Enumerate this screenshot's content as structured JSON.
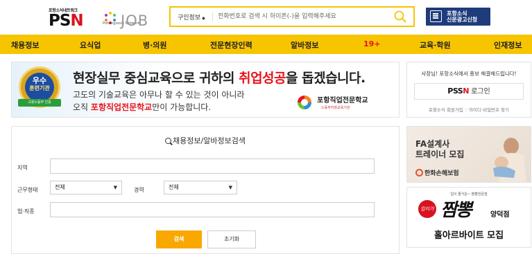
{
  "header": {
    "logo_tagline": "포항소식네트워크",
    "logo_psn_a": "PS",
    "logo_psn_b": "N",
    "logo_sub": "Pohangsosik Network",
    "logo_job": "JOB",
    "search_category": "구인정보",
    "search_placeholder": "전화번호로 검색 시 하이픈(-)을 입력해주세요",
    "ad_button_line1": "포항소식",
    "ad_button_line2": "신문광고신청"
  },
  "nav": {
    "items": [
      "채용정보",
      "요식업",
      "병·의원",
      "전문현장인력",
      "알바정보",
      "19+",
      "교육·학원",
      "인재정보"
    ]
  },
  "banner": {
    "medal_top": "우수",
    "medal_mid": "훈련기관",
    "medal_ribbon": "고용노동부 인증",
    "headline_pre": "현장실무 중심교육으로 귀하의 ",
    "headline_hl": "취업성공",
    "headline_post": "을 돕겠습니다.",
    "line2": "고도의 기술교육은 아무나 할 수 있는 것이 아니라",
    "line3_pre": "오직 ",
    "line3_hl": "포항직업전문학교",
    "line3_post": "만이 가능합니다.",
    "school_name": "포항직업전문학교",
    "school_sub": "노동부지정교육기관"
  },
  "login": {
    "message": "사장님! 포항소식에서 홍보 해결해드립니다!",
    "button_brand_a": "PSS",
    "button_brand_b": "N",
    "button_label": "로그인",
    "link_signup": "포항소식 회원가입",
    "link_find": "아이디·비밀번호 찾기"
  },
  "search_form": {
    "title": "채용정보/알바정보검색",
    "region_label": "지역",
    "worktype_label": "근무형태",
    "worktype_value": "전체",
    "career_label": "경력",
    "career_value": "전체",
    "job_label": "업·직종",
    "search_button": "검색",
    "reset_button": "초기화"
  },
  "side_ads": {
    "ad1_line1": "FA설계사",
    "ad1_line2": "트레이너 모집",
    "ad1_brand": "한화손해보험",
    "ad2_small": "입이 즐거운~ 짬뽕전문점",
    "ad2_badge": "입이가",
    "ad2_brush": "짬뽕",
    "ad2_branch": "양덕점",
    "ad2_big": "홀아르바이트 모집"
  },
  "colors": {
    "nav_bg": "#f7c500",
    "accent_red": "#e8141d",
    "search_button": "#f8a800",
    "ad_button_bg": "#1e3b7a"
  }
}
